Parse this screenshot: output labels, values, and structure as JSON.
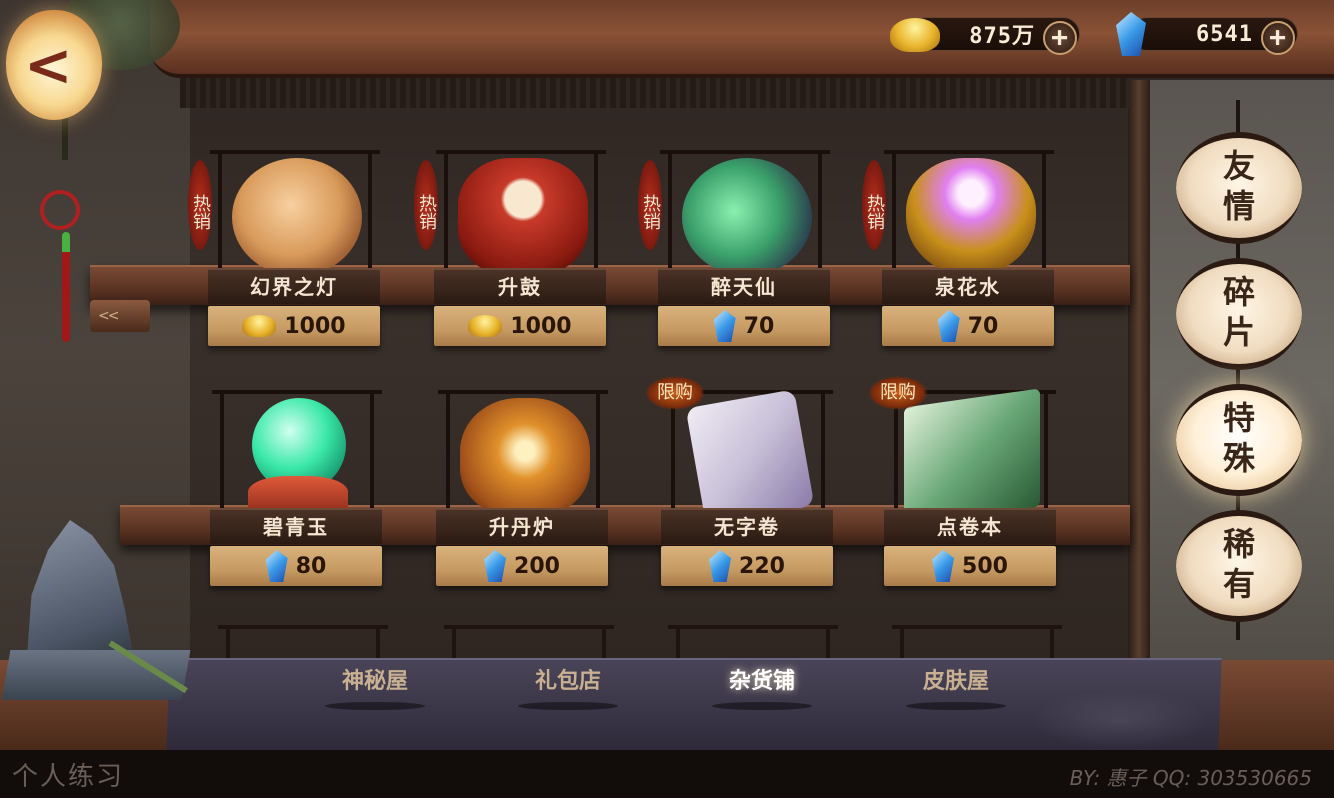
{
  "currency": {
    "gold": {
      "value": "875万",
      "icon": "gold-ingot-icon",
      "add": "+"
    },
    "gem": {
      "value": "6541",
      "icon": "crystal-icon",
      "add": "+"
    }
  },
  "back": {
    "icon": "back-arrow-icon",
    "glyph": "<"
  },
  "items": [
    {
      "name": "幻界之灯",
      "price": "1000",
      "currency": "gold",
      "tag": "热销",
      "tag_type": "hot",
      "color": "#d89a5a"
    },
    {
      "name": "升鼓",
      "price": "1000",
      "currency": "gold",
      "tag": "热销",
      "tag_type": "hot",
      "color": "#c83a2a"
    },
    {
      "name": "醉天仙",
      "price": "70",
      "currency": "gem",
      "tag": "热销",
      "tag_type": "hot",
      "color": "#3aa06a"
    },
    {
      "name": "泉花水",
      "price": "70",
      "currency": "gem",
      "tag": "热销",
      "tag_type": "hot",
      "color": "#c878d8"
    },
    {
      "name": "碧青玉",
      "price": "80",
      "currency": "gem",
      "tag": "",
      "tag_type": "",
      "color": "#3ae8a8"
    },
    {
      "name": "升丹炉",
      "price": "200",
      "currency": "gem",
      "tag": "",
      "tag_type": "",
      "color": "#e0902a"
    },
    {
      "name": "无字卷",
      "price": "220",
      "currency": "gem",
      "tag": "限购",
      "tag_type": "limit",
      "color": "#c8c0d8"
    },
    {
      "name": "点卷本",
      "price": "500",
      "currency": "gem",
      "tag": "限购",
      "tag_type": "limit",
      "color": "#6aa878"
    }
  ],
  "side_tabs": [
    {
      "label": "友情",
      "active": false
    },
    {
      "label": "碎片",
      "active": false
    },
    {
      "label": "特殊",
      "active": true
    },
    {
      "label": "稀有",
      "active": false
    }
  ],
  "bottom_tabs": [
    {
      "label": "神秘屋",
      "active": false
    },
    {
      "label": "礼包店",
      "active": false
    },
    {
      "label": "杂货铺",
      "active": true
    },
    {
      "label": "皮肤屋",
      "active": false
    }
  ],
  "shelf_arrow": "<<",
  "footer": {
    "left": "个人练习",
    "right": "BY: 惠子   QQ: 303530665"
  }
}
